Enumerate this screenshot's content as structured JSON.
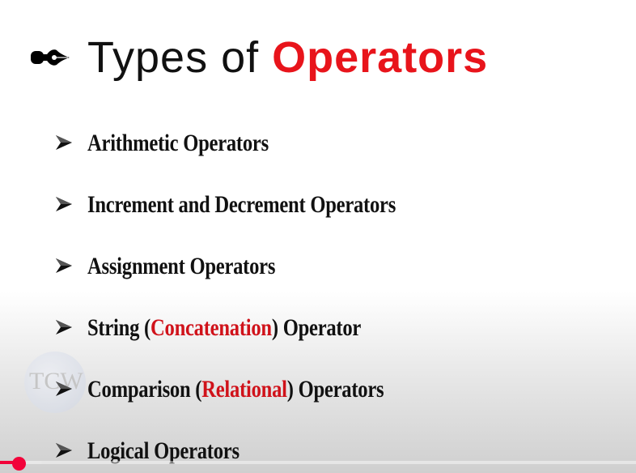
{
  "slide": {
    "title_prefix": "Types of",
    "title_accent": "Operators",
    "items": [
      {
        "before": "Arithmetic Operators",
        "highlight": "",
        "after": ""
      },
      {
        "before": "Increment and Decrement Operators",
        "highlight": "",
        "after": ""
      },
      {
        "before": "Assignment Operators",
        "highlight": "",
        "after": ""
      },
      {
        "before": "String (",
        "highlight": "Concatenation",
        "after": ") Operator"
      },
      {
        "before": "Comparison (",
        "highlight": "Relational",
        "after": ") Operators"
      },
      {
        "before": "Logical Operators",
        "highlight": "",
        "after": ""
      }
    ],
    "watermark": "TCW"
  },
  "player": {
    "progress_percent": 3,
    "buffered_percent": 6.5
  },
  "colors": {
    "accent": "#e8141b",
    "progress": "#f2033a"
  }
}
